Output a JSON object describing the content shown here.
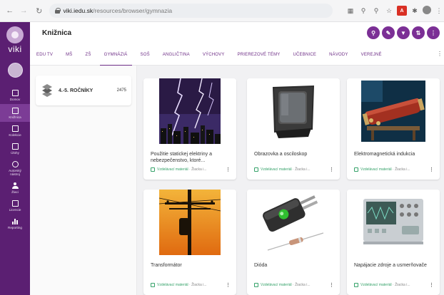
{
  "browser": {
    "url_domain": "viki.iedu.sk",
    "url_path": "/resources/browser/gymnazia"
  },
  "sidebar": {
    "logo": "viki",
    "items": [
      {
        "label": "Domov"
      },
      {
        "label": "Knižnica"
      },
      {
        "label": "Kolekcie"
      },
      {
        "label": "Úlohy"
      },
      {
        "label": "Autorský nástroj"
      },
      {
        "label": "Žiaci"
      },
      {
        "label": "Licencie"
      },
      {
        "label": "Reporting"
      }
    ]
  },
  "header": {
    "title": "Knižnica"
  },
  "tabs": [
    {
      "label": "EDU TV"
    },
    {
      "label": "MŠ"
    },
    {
      "label": "ZŠ"
    },
    {
      "label": "GYMNÁZIÁ"
    },
    {
      "label": "SOŠ"
    },
    {
      "label": "ANGLIČTINA"
    },
    {
      "label": "VÝCHOVY"
    },
    {
      "label": "PRIEREZOVÉ TÉMY"
    },
    {
      "label": "UČEBNICE"
    },
    {
      "label": "NÁVODY"
    },
    {
      "label": "VEREJNÉ"
    }
  ],
  "active_tab": "GYMNÁZIÁ",
  "category": {
    "label": "4.-5. ROČNÍKY",
    "count": "2475"
  },
  "cards": [
    {
      "title": "Použitie statickej elektriny a nebezpečenstvo, ktoré...",
      "type": "Vzdelávací materiál",
      "author": "Žiacka i..."
    },
    {
      "title": "Obrazovka a osciloskop",
      "type": "Vzdelávací materiál",
      "author": "Žiacka i..."
    },
    {
      "title": "Elektromagnetická indukcia",
      "type": "Vzdelávací materiál",
      "author": "Žiacka i..."
    },
    {
      "title": "Transformátor",
      "type": "Vzdelávací materiál",
      "author": "Žiacka i..."
    },
    {
      "title": "Dióda",
      "type": "Vzdelávací materiál",
      "author": "Žiacka i..."
    },
    {
      "title": "Napájacie zdroje a usmerňovače",
      "type": "Vzdelávací materiál",
      "author": "Žiacka i..."
    }
  ],
  "colors": {
    "brand_purple": "#5b1f72",
    "accent_purple": "#7b2f95",
    "material_green": "#36a26a"
  }
}
